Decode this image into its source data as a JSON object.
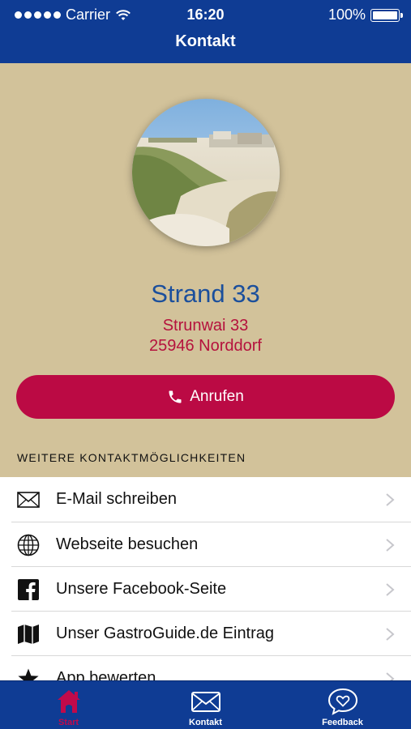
{
  "status_bar": {
    "carrier": "Carrier",
    "time": "16:20",
    "battery": "100%"
  },
  "header": {
    "title": "Kontakt"
  },
  "venue": {
    "name": "Strand 33",
    "street": "Strunwai 33",
    "city": "25946 Norddorf"
  },
  "call_button": {
    "label": "Anrufen"
  },
  "section": {
    "title": "WEITERE KONTAKTMÖGLICHKEITEN"
  },
  "contact_options": [
    {
      "label": "E-Mail schreiben",
      "icon": "envelope-icon"
    },
    {
      "label": "Webseite besuchen",
      "icon": "globe-icon"
    },
    {
      "label": "Unsere Facebook-Seite",
      "icon": "facebook-icon"
    },
    {
      "label": "Unser GastroGuide.de Eintrag",
      "icon": "map-icon"
    },
    {
      "label": "App bewerten",
      "icon": "star-icon"
    }
  ],
  "tabbar": {
    "tabs": [
      {
        "label": "Start",
        "icon": "home-icon",
        "active": true
      },
      {
        "label": "Kontakt",
        "icon": "envelope-icon",
        "active": false
      },
      {
        "label": "Feedback",
        "icon": "heart-bubble-icon",
        "active": false
      }
    ]
  },
  "colors": {
    "brand": "#0f3c94",
    "accent": "#bb0a44",
    "background": "#d2c29a",
    "name": "#1b4f9c"
  }
}
